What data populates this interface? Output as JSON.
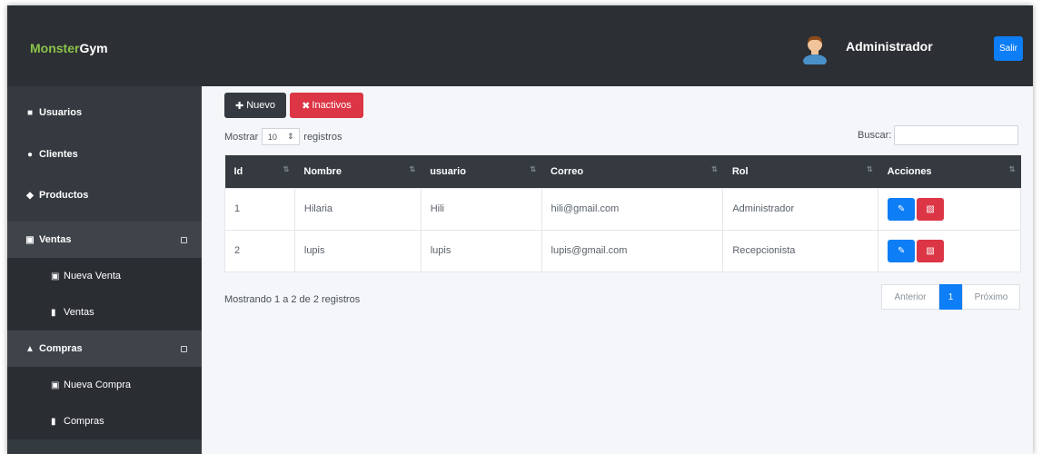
{
  "brand": {
    "part1": "Monster",
    "part2": "Gym"
  },
  "header": {
    "user_name": "Administrador",
    "logout_label": "Salir"
  },
  "sidebar": {
    "items": [
      {
        "label": "Usuarios",
        "icon": "user-icon"
      },
      {
        "label": "Clientes",
        "icon": "users-icon"
      },
      {
        "label": "Productos",
        "icon": "tags-icon"
      },
      {
        "label": "Ventas",
        "icon": "cart-icon",
        "sub": [
          {
            "label": "Nueva Venta",
            "icon": "cart-icon"
          },
          {
            "label": "Ventas",
            "icon": "file-icon"
          }
        ]
      },
      {
        "label": "Compras",
        "icon": "bag-icon",
        "sub": [
          {
            "label": "Nueva Compra",
            "icon": "cart-icon"
          },
          {
            "label": "Compras",
            "icon": "file-icon"
          }
        ]
      }
    ]
  },
  "toolbar": {
    "new_label": "Nuevo",
    "inactive_label": "Inactivos"
  },
  "table_controls": {
    "show_label": "Mostrar",
    "page_length": "10",
    "records_label": "registros",
    "search_label": "Buscar:",
    "search_value": ""
  },
  "table": {
    "columns": [
      "Id",
      "Nombre",
      "usuario",
      "Correo",
      "Rol",
      "Acciones"
    ],
    "rows": [
      [
        "1",
        "Hilaria",
        "Hili",
        "hili@gmail.com",
        "Administrador"
      ],
      [
        "2",
        "lupis",
        "lupis",
        "lupis@gmail.com",
        "Recepcionista"
      ]
    ]
  },
  "footer": {
    "info": "Mostrando 1 a 2 de 2 registros",
    "prev_label": "Anterior",
    "page": "1",
    "next_label": "Próximo"
  },
  "colors": {
    "navbar": "#2c2f33",
    "sidebar": "#343a40",
    "primary": "#0d7ef5",
    "danger": "#dc3545",
    "brand_accent": "#8bc34a"
  }
}
